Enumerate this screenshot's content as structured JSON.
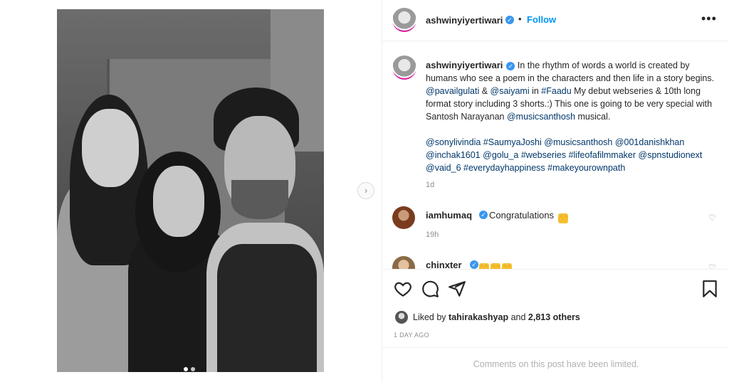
{
  "header": {
    "username": "ashwinyiyertiwari",
    "separator": "•",
    "follow_label": "Follow",
    "more_label": "•••"
  },
  "carousel": {
    "next_label": "›",
    "dots_total": 2,
    "active_index": 0
  },
  "caption": {
    "username": "ashwinyiyertiwari",
    "text_1": "In the rhythm of words a world is created by humans who see a poem in the characters and then life in a story begins. ",
    "mention_1": "@pavailgulati",
    "amp": " & ",
    "mention_2": "@saiyami",
    "in": " in ",
    "tag_1": "#Faadu",
    "text_2": " My debut webseries & 10th long format story including 3 shorts.:) This one is going to be very special with Santosh Narayanan ",
    "mention_3": "@musicsanthosh",
    "text_3": " musical.",
    "tags_line": [
      "@sonylivindia",
      "#SaumyaJoshi",
      "@musicsanthosh",
      "@001danishkhan",
      "@inchak1601",
      "@golu_a",
      "#webseries",
      "#lifeofafilmmaker",
      "@spnstudionext",
      "@vaid_6",
      "#everydayhappiness",
      "#makeyourownpath"
    ],
    "time": "1d"
  },
  "comments": [
    {
      "username": "iamhumaq",
      "text": "Congratulations",
      "emoji_count": 1,
      "time": "19h"
    },
    {
      "username": "chinxter",
      "text": "",
      "emoji_count": 3,
      "time": ""
    }
  ],
  "icons": {
    "like": "heart-icon",
    "comment": "comment-icon",
    "share": "send-icon",
    "save": "bookmark-icon",
    "comment_like": "heart-outline-icon"
  },
  "likes": {
    "prefix": "Liked by ",
    "user": "tahirakashyap",
    "middle": " and ",
    "count": "2,813 others"
  },
  "post_time": "1 DAY AGO",
  "comments_limited": "Comments on this post have been limited.",
  "colors": {
    "link": "#00376b",
    "follow": "#0095f6",
    "verified": "#3897f0",
    "muted": "#8e8e8e"
  }
}
